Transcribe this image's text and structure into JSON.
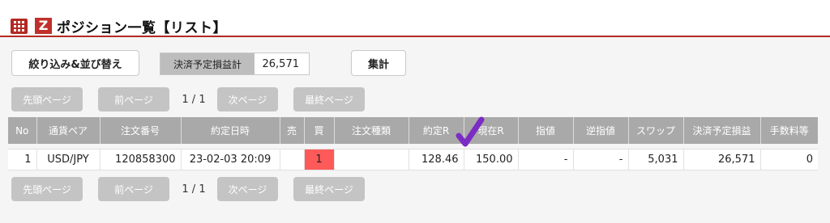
{
  "header": {
    "title": "ポジション一覧【リスト】",
    "logo_letter": "Z"
  },
  "toolbar": {
    "sort_label": "絞り込み&並び替え",
    "summary_label": "決済予定損益計",
    "summary_value": "26,571",
    "total_label": "集計"
  },
  "pager": {
    "first": "先頭ページ",
    "prev": "前ページ",
    "info": "1 / 1",
    "next": "次ページ",
    "last": "最終ページ"
  },
  "table": {
    "headers": [
      "No",
      "通貨ペア",
      "注文番号",
      "約定日時",
      "売",
      "買",
      "注文種類",
      "約定R",
      "現在R",
      "指値",
      "逆指値",
      "スワップ",
      "決済予定損益",
      "手数料等"
    ],
    "rows": [
      {
        "no": "1",
        "pair": "USD/JPY",
        "order_no": "120858300",
        "datetime": "23-02-03 20:09",
        "sell": "",
        "buy": "1",
        "order_type": "",
        "entry_rate": "128.46",
        "current_rate": "150.00",
        "limit": "-",
        "stop": "-",
        "swap": "5,031",
        "pl": "26,571",
        "fee": "0"
      }
    ]
  },
  "colors": {
    "brand": "#b32a22",
    "buy_highlight": "#ff5a5a",
    "annotation": "#7b2cc4"
  },
  "icons": {
    "menu": "grid-menu-icon",
    "logo": "z-logo-icon",
    "annotation": "checkmark-icon"
  }
}
